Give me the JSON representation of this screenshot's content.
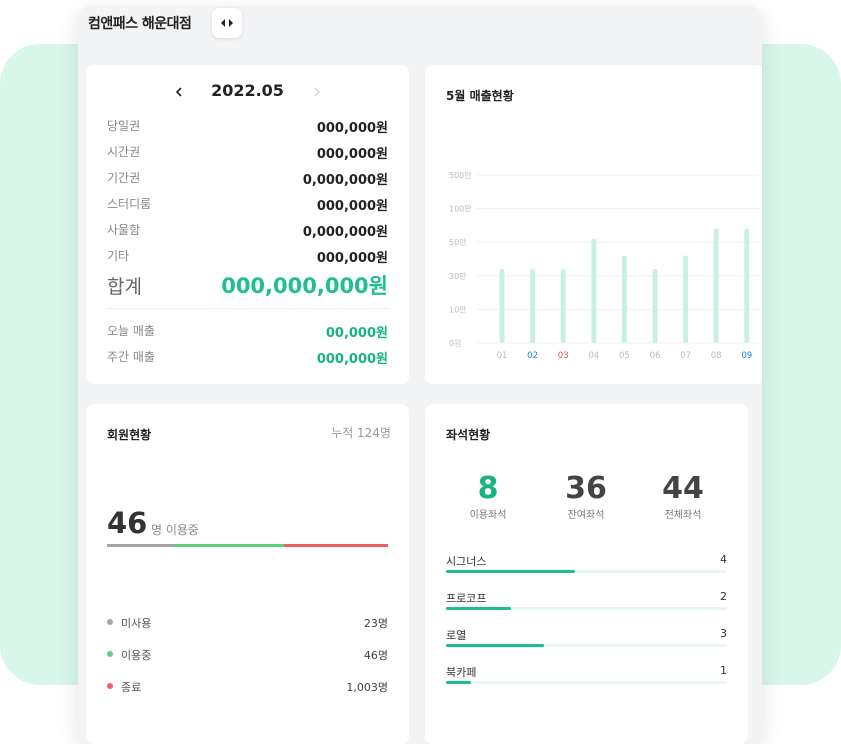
{
  "store": {
    "title": "컴앤패스 해운대점"
  },
  "sales": {
    "month": "2022.05",
    "rows": [
      {
        "label": "당일권",
        "value": "000,000원"
      },
      {
        "label": "시간권",
        "value": "000,000원"
      },
      {
        "label": "기간권",
        "value": "0,000,000원"
      },
      {
        "label": "스터디룸",
        "value": "000,000원"
      },
      {
        "label": "사물함",
        "value": "0,000,000원"
      },
      {
        "label": "기타",
        "value": "000,000원"
      }
    ],
    "total": {
      "label": "합계",
      "value": "000,000,000원"
    },
    "today": {
      "label": "오늘 매출",
      "value": "00,000원"
    },
    "week": {
      "label": "주간 매출",
      "value": "000,000원"
    }
  },
  "chart": {
    "title": "5월 매출현황",
    "colors": {
      "bar": "#c8f1e2",
      "grid": "#f0f0f0",
      "axis_text": "#bbbbbb",
      "saturday": "#1e7fd6",
      "sunday": "#e0534a"
    },
    "chart_data": {
      "type": "bar",
      "title": "5월 매출현황",
      "y_ticks": [
        "500만",
        "100만",
        "50만",
        "30만",
        "10만",
        "0원"
      ],
      "categories": [
        "01",
        "02",
        "03",
        "04",
        "05",
        "06",
        "07",
        "08",
        "09"
      ],
      "category_colors": [
        "#bbbbbb",
        "#1e7fd6",
        "#e0534a",
        "#bbbbbb",
        "#bbbbbb",
        "#bbbbbb",
        "#bbbbbb",
        "#bbbbbb",
        "#1e7fd6"
      ],
      "values": [
        2.2,
        2.2,
        2.2,
        3.1,
        2.6,
        2.2,
        2.6,
        3.4,
        3.4
      ],
      "value_scale": "tick index (0원=0, 10만=1, 30만=2, 50만=3, 100만=4, 500만=5)",
      "grid": true
    }
  },
  "members": {
    "title": "회원현황",
    "cumulative": "누적 124명",
    "count": "46",
    "count_label": "명 이용중",
    "bar_segments": [
      {
        "share": 0.24,
        "color": "#a5a5a5"
      },
      {
        "share": 0.39,
        "color": "#5fcf82"
      },
      {
        "share": 0.37,
        "color": "#ee5f67"
      }
    ],
    "legend": [
      {
        "label": "미사용",
        "value": "23명",
        "color": "#a5a5a5"
      },
      {
        "label": "이용중",
        "value": "46명",
        "color": "#5fcf82"
      },
      {
        "label": "종료",
        "value": "1,003명",
        "color": "#ee5f67"
      }
    ]
  },
  "seats": {
    "title": "좌석현황",
    "stats": [
      {
        "num": "8",
        "label": "이용좌석",
        "color": "#17b47e"
      },
      {
        "num": "36",
        "label": "잔여좌석",
        "color": "#444444"
      },
      {
        "num": "44",
        "label": "전체좌석",
        "color": "#444444"
      }
    ],
    "items": [
      {
        "name": "시그너스",
        "count": "4",
        "fill": 0.46
      },
      {
        "name": "프로코프",
        "count": "2",
        "fill": 0.23
      },
      {
        "name": "로열",
        "count": "3",
        "fill": 0.35
      },
      {
        "name": "북카페",
        "count": "1",
        "fill": 0.09
      }
    ]
  }
}
